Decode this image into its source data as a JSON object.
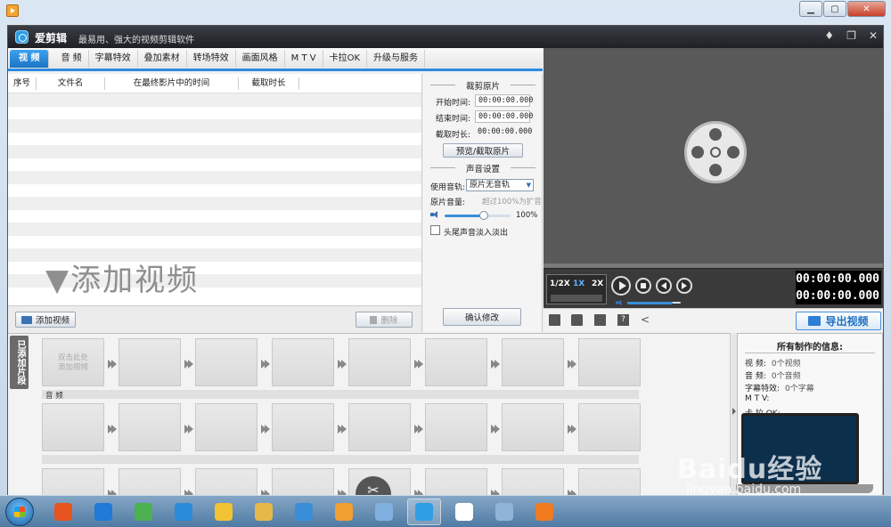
{
  "app": {
    "name": "爱剪辑",
    "slogan": "最易用、强大的视频剪辑软件",
    "window_controls": [
      "♦",
      "❐",
      "✕"
    ]
  },
  "tabs": [
    {
      "label": "视  频",
      "active": true
    },
    {
      "label": "音  频"
    },
    {
      "label": "字幕特效"
    },
    {
      "label": "叠加素材"
    },
    {
      "label": "转场特效"
    },
    {
      "label": "画面风格"
    },
    {
      "label": "M T V"
    },
    {
      "label": "卡拉OK"
    },
    {
      "label": "升级与服务"
    }
  ],
  "file_list": {
    "columns": [
      "序号",
      "文件名",
      "在最终影片中的时间",
      "截取时长"
    ],
    "empty_hint": "▼添加视频"
  },
  "footer": {
    "add_video": "添加视频",
    "delete": "删除",
    "confirm": "确认修改"
  },
  "clip": {
    "section_title": "裁剪原片",
    "start_label": "开始时间:",
    "start_value": "00:00:00.000",
    "end_label": "结束时间:",
    "end_value": "00:00:00.000",
    "duration_label": "截取时长:",
    "duration_value": "00:00:00.000",
    "preview_button": "预览/截取原片"
  },
  "audio": {
    "section_title": "声音设置",
    "track_label": "使用音轨:",
    "track_value": "原片无音轨",
    "volume_label": "原片音量:",
    "volume_hint": "超过100%为扩音",
    "volume_value": "100%",
    "volume_fraction": 0.6,
    "fade_label": "头尾声音淡入淡出"
  },
  "player": {
    "speeds": [
      "1/2X",
      "1X",
      "2X"
    ],
    "active_speed": "1X",
    "time_current": "00:00:00.000",
    "time_total": "00:00:00.000",
    "volume_fraction": 0.85,
    "export_label": "导出视频"
  },
  "timeline": {
    "side_label": "已添加片段",
    "first_slot_text": "双击此处\n添加视频",
    "audio_label": "音 频"
  },
  "info": {
    "title": "所有制作的信息:",
    "rows": [
      {
        "label": "视    频:",
        "value": "0个视频"
      },
      {
        "label": "音    频:",
        "value": "0个音频"
      },
      {
        "label": "字幕特效:",
        "value": "0个字幕"
      },
      {
        "label": "M  T  V:",
        "value": ""
      },
      {
        "label": "卡 拉 OK:",
        "value": ""
      }
    ]
  },
  "watermark": {
    "brand": "Baidu经验",
    "url": "jingyan.baidu.com"
  },
  "taskbar": {
    "items": [
      {
        "name": "jiangmin-icon",
        "color": "#e7541f"
      },
      {
        "name": "ie-icon",
        "color": "#1e7ad6"
      },
      {
        "name": "chrome-icon",
        "color": "#4caf50"
      },
      {
        "name": "cloud-icon",
        "color": "#2a8bd9"
      },
      {
        "name": "folder-icon",
        "color": "#f1c232"
      },
      {
        "name": "explorer-icon",
        "color": "#e6b84a"
      },
      {
        "name": "qq-icon",
        "color": "#3a8ed8"
      },
      {
        "name": "player-icon",
        "color": "#f0a030"
      },
      {
        "name": "paint-icon",
        "color": "#7fb0e0"
      },
      {
        "name": "aijianji-icon",
        "color": "#2f9de4",
        "active": true
      },
      {
        "name": "cube-icon",
        "color": "#ffffff"
      },
      {
        "name": "network-icon",
        "color": "#8fb4d8"
      },
      {
        "name": "media-icon",
        "color": "#f07a20"
      }
    ]
  }
}
